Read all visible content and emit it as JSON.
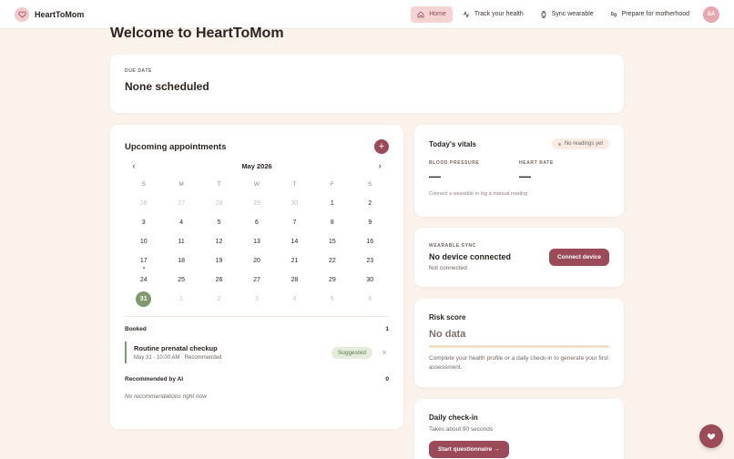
{
  "app": {
    "brand": "HeartToMom"
  },
  "nav": {
    "items": [
      {
        "label": "Home",
        "icon": "home-icon",
        "active": true
      },
      {
        "label": "Track your health",
        "icon": "activity-icon",
        "active": false
      },
      {
        "label": "Sync wearable",
        "icon": "watch-icon",
        "active": false
      },
      {
        "label": "Prepare for motherhood",
        "icon": "footprints-icon",
        "active": false
      }
    ],
    "avatar_initials": "SA"
  },
  "page": {
    "title": "Welcome to HeartToMom"
  },
  "due_date": {
    "label": "DUE DATE",
    "value": "None scheduled"
  },
  "appointments": {
    "title": "Upcoming appointments",
    "add_label": "+",
    "calendar": {
      "month": "May 2026",
      "prev": "‹",
      "next": "›",
      "weekdays": [
        "S",
        "M",
        "T",
        "W",
        "T",
        "F",
        "S"
      ],
      "weeks": [
        [
          "26",
          "27",
          "28",
          "29",
          "30",
          "1",
          "2"
        ],
        [
          "3",
          "4",
          "5",
          "6",
          "7",
          "8",
          "9"
        ],
        [
          "10",
          "11",
          "12",
          "13",
          "14",
          "15",
          "16"
        ],
        [
          "17",
          "18",
          "19",
          "20",
          "21",
          "22",
          "23"
        ],
        [
          "24",
          "25",
          "26",
          "27",
          "28",
          "29",
          "30"
        ],
        [
          "31",
          "1",
          "2",
          "3",
          "4",
          "5",
          "6"
        ]
      ],
      "selected_day": "31",
      "marked_day": "17"
    },
    "booked": {
      "label": "Booked",
      "count": "1",
      "items": [
        {
          "name": "Routine prenatal checkup",
          "meta": "May 31 · 10:00 AM · Recommended",
          "badge": "Suggested",
          "dismiss": "×"
        }
      ]
    },
    "recommended": {
      "label": "Recommended by AI",
      "count": "0",
      "empty": "No recommendations right now"
    }
  },
  "vitals": {
    "title": "Today's vitals",
    "status": "No readings yet",
    "blood_pressure": {
      "label": "BLOOD PRESSURE",
      "value": "—"
    },
    "heart_rate": {
      "label": "HEART RATE",
      "value": "—"
    },
    "note": "Connect a wearable or log a manual reading"
  },
  "wearable": {
    "label": "WEARABLE SYNC",
    "title": "No device connected",
    "status": "Not connected",
    "button": "Connect device"
  },
  "risk": {
    "title": "Risk score",
    "value": "No data",
    "note": "Complete your health profile or a daily check-in to generate your first assessment."
  },
  "daily": {
    "title": "Daily check-in",
    "subtitle": "Takes about 90 seconds",
    "button": "Start questionnaire →"
  },
  "colors": {
    "accent": "#9b4b57",
    "background": "#fbf2ec",
    "success": "#7f9a6e",
    "nav_active": "#f6d3d3"
  },
  "fab": {
    "icon": "heart-icon"
  }
}
